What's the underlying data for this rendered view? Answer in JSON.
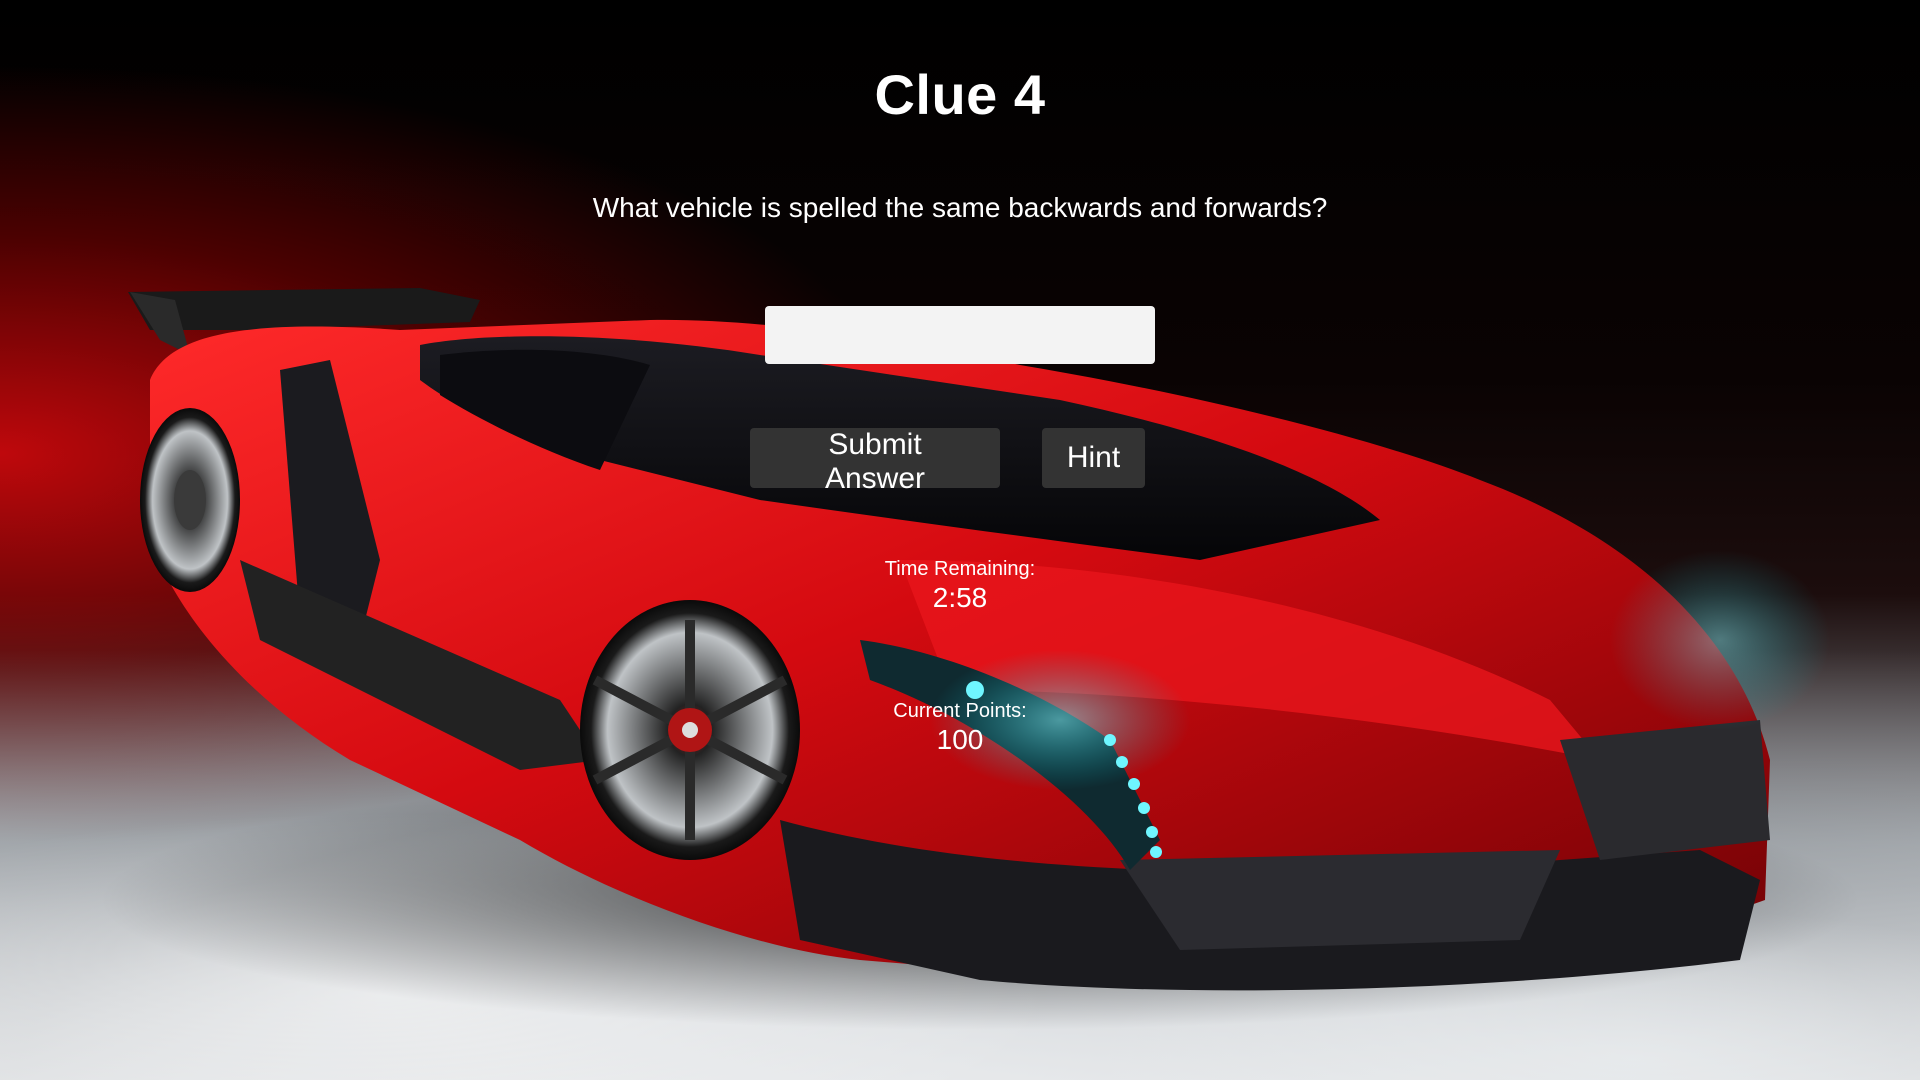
{
  "page": {
    "title": "Clue 4",
    "question": "What vehicle is spelled the same backwards and forwards?"
  },
  "answer": {
    "value": "",
    "placeholder": ""
  },
  "buttons": {
    "submit_label": "Submit Answer",
    "hint_label": "Hint"
  },
  "stats": {
    "time_label": "Time Remaining:",
    "time_value": "2:58",
    "points_label": "Current Points:",
    "points_value": "100"
  },
  "colors": {
    "button_bg": "#333333",
    "input_bg": "#f3f3f3",
    "text": "#ffffff",
    "car_red": "#d40a10",
    "headlight_cyan": "#3fe3ef"
  },
  "background": {
    "image": "red-supercar-photo"
  }
}
